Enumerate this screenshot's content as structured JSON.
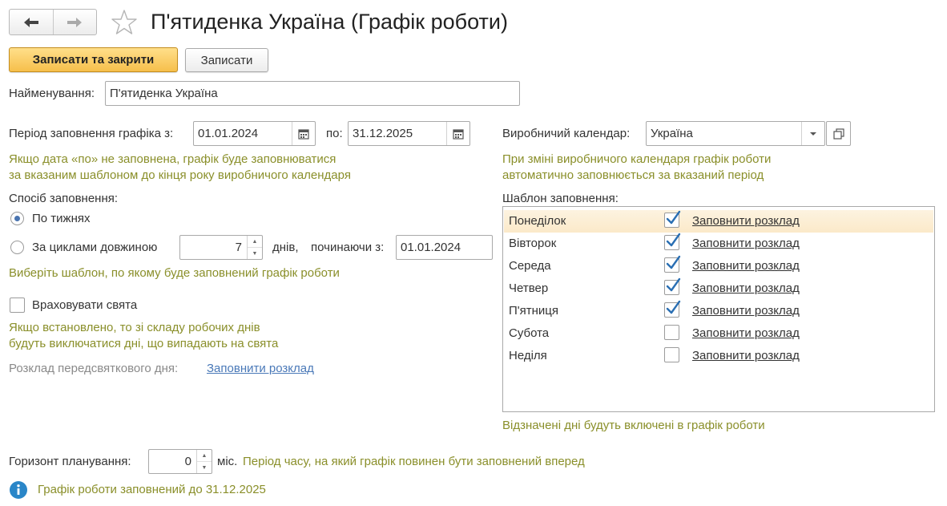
{
  "header": {
    "title": "П'ятиденка Україна (Графік роботи)",
    "save_close_label": "Записати та закрити",
    "save_label": "Записати"
  },
  "name_field": {
    "label": "Найменування:",
    "value": "П'ятиденка Україна"
  },
  "period": {
    "label": "Період заповнення графіка з:",
    "from": "01.01.2024",
    "to_label": "по:",
    "to": "31.12.2025",
    "hint_line1": "Якщо дата «по» не заповнена, графік буде заповнюватися",
    "hint_line2": "за вказаним шаблоном до кінця року виробничого календаря"
  },
  "fill_method": {
    "label": "Спосіб заповнення:",
    "option_weeks": "По тижнях",
    "option_cycles": "За циклами довжиною",
    "cycle_length": "7",
    "days_label": "днів,",
    "start_label": "починаючи з:",
    "start_date": "01.01.2024",
    "hint": "Виберіть шаблон, по якому буде заповнений графік роботи"
  },
  "holidays": {
    "label": "Враховувати свята",
    "hint_line1": "Якщо встановлено, то зі складу робочих днів",
    "hint_line2": "будуть виключатися дні, що випадають на свята",
    "preholiday_label": "Розклад передсвяткового дня:",
    "preholiday_link": "Заповнити розклад"
  },
  "calendar": {
    "label": "Виробничий календар:",
    "value": "Україна",
    "hint_line1": "При зміні виробничого календаря графік роботи",
    "hint_line2": "автоматично заповнюється за вказаний період"
  },
  "template": {
    "label": "Шаблон заповнення:",
    "rows": [
      {
        "day": "Понеділок",
        "checked": true,
        "link": "Заповнити розклад"
      },
      {
        "day": "Вівторок",
        "checked": true,
        "link": "Заповнити розклад"
      },
      {
        "day": "Середа",
        "checked": true,
        "link": "Заповнити розклад"
      },
      {
        "day": "Четвер",
        "checked": true,
        "link": "Заповнити розклад"
      },
      {
        "day": "П'ятниця",
        "checked": true,
        "link": "Заповнити розклад"
      },
      {
        "day": "Субота",
        "checked": false,
        "link": "Заповнити розклад"
      },
      {
        "day": "Неділя",
        "checked": false,
        "link": "Заповнити розклад"
      }
    ],
    "footer": "Відзначені дні будуть включені в графік роботи"
  },
  "horizon": {
    "label": "Горизонт планування:",
    "value": "0",
    "unit": "міс.",
    "hint": "Період часу, на який графік повинен бути заповнений вперед"
  },
  "info": {
    "text": "Графік роботи заповнений до 31.12.2025"
  },
  "colors": {
    "accent": "#f6bf4b",
    "hint": "#8a8f2a",
    "link_blue": "#4a79b8",
    "check": "#2a6fb3",
    "info": "#2a86c8"
  }
}
